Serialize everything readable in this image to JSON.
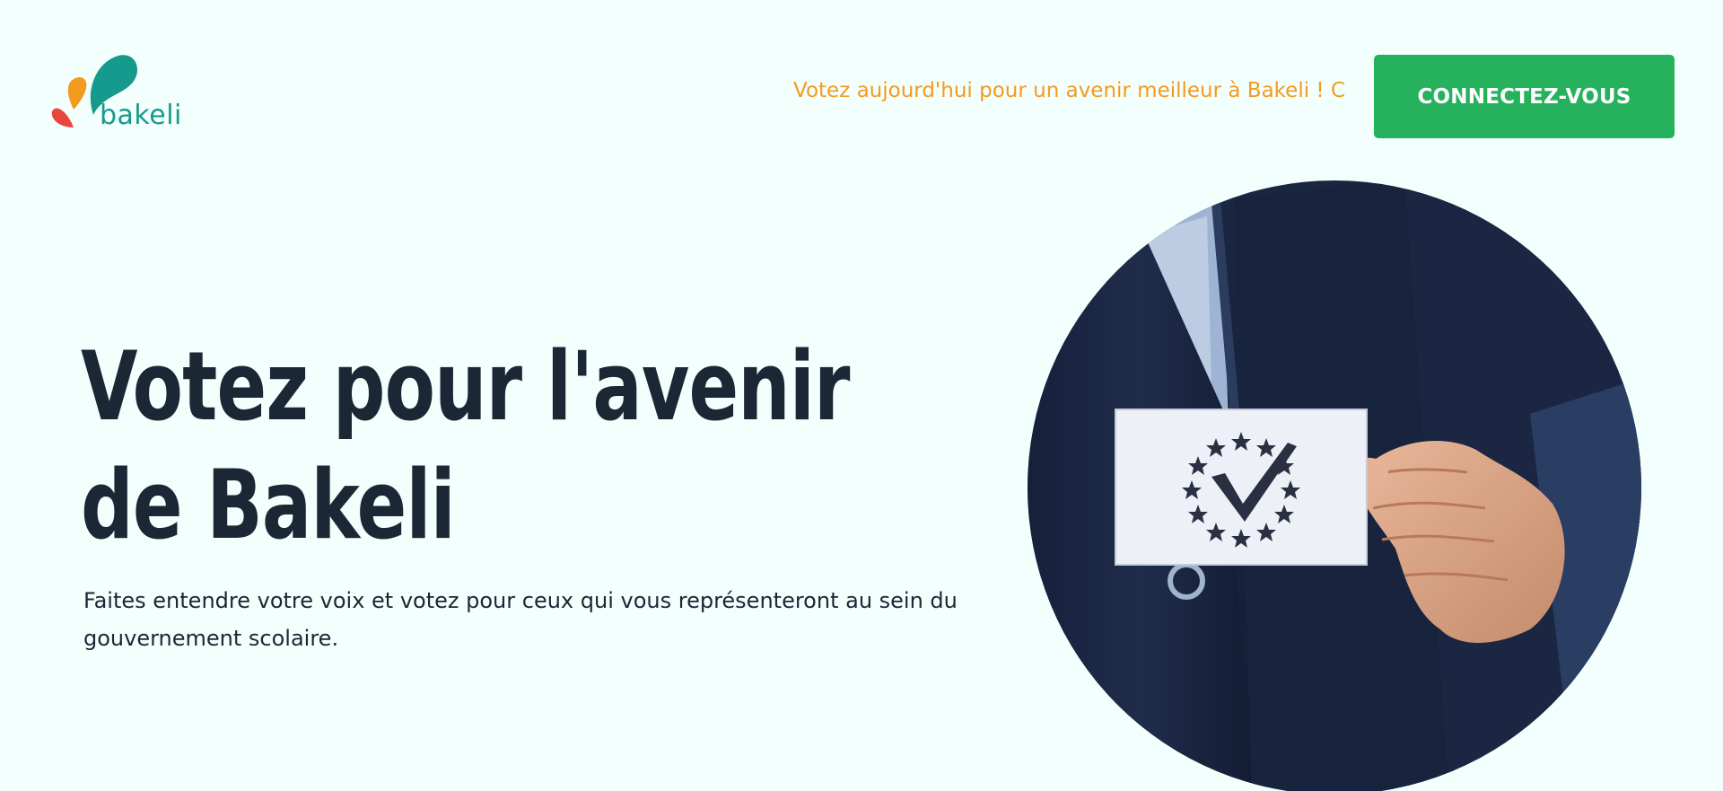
{
  "brand": {
    "name": "bakeli",
    "colors": {
      "teal": "#169a8e",
      "orange": "#f39b1f",
      "red": "#e8453c"
    }
  },
  "header": {
    "announcement": "Votez aujourd'hui pour un avenir meilleur à Bakeli ! C",
    "cta_label": "CONNECTEZ-VOUS"
  },
  "hero": {
    "title_line1": "Votez pour l'avenir",
    "title_line2": "de Bakeli",
    "subtitle": "Faites entendre votre voix et votez pour ceux qui vous représenteront au sein du gouvernement scolaire."
  },
  "hero_image": {
    "icon": "vote-checkmark-stars-icon"
  },
  "colors": {
    "background": "#f3fffc",
    "title": "#1b2734",
    "button": "#26b25d",
    "announcement": "#f39b1f"
  }
}
